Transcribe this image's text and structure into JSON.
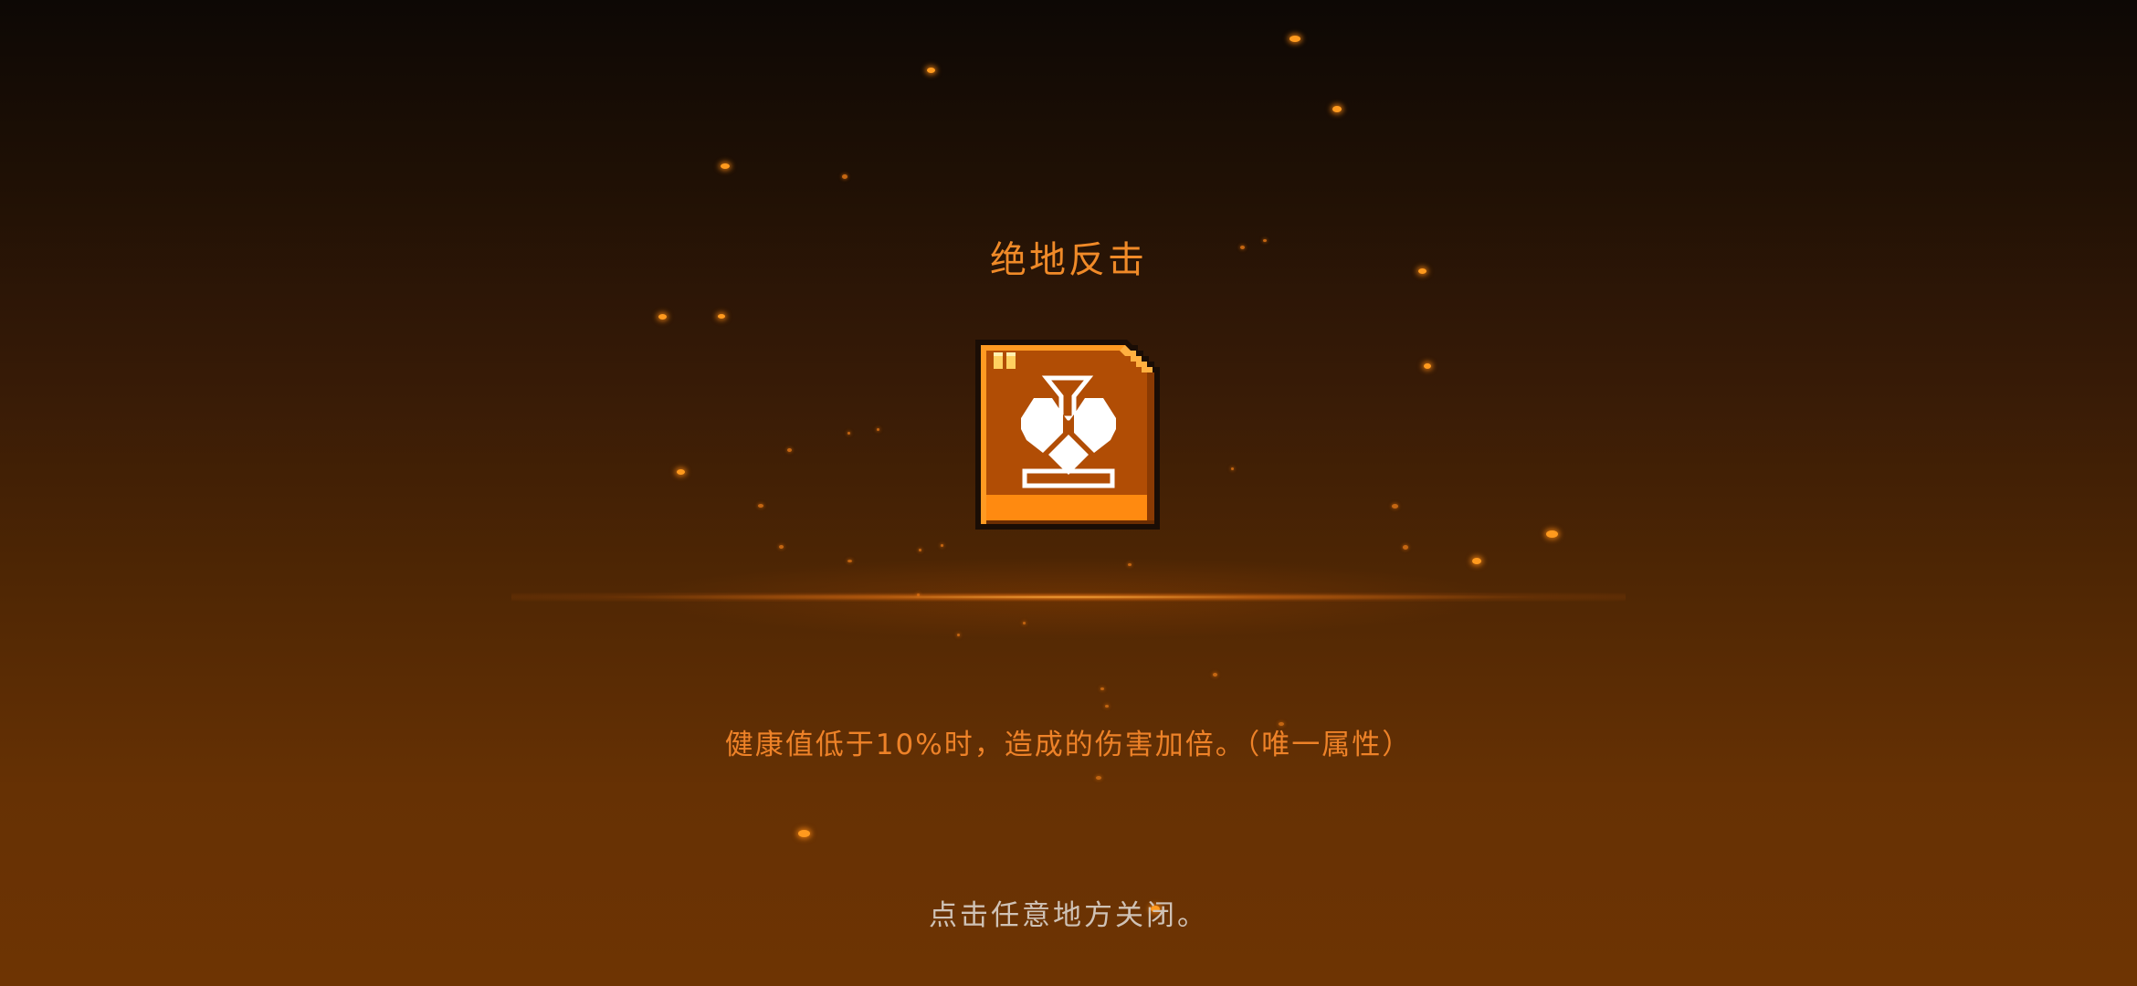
{
  "talent": {
    "name": "绝地反击",
    "description": "健康值低于10%时，造成的伤害加倍。（唯一属性）",
    "icon": "counterattack-talent-icon"
  },
  "close_hint": "点击任意地方关闭。",
  "colors": {
    "accent": "#f08a28",
    "description": "#ee8228",
    "hint": "#cfc2b6",
    "badge_fill": "#b14d05",
    "badge_highlight": "#ff8a10",
    "badge_outline": "#1a0d05"
  }
}
